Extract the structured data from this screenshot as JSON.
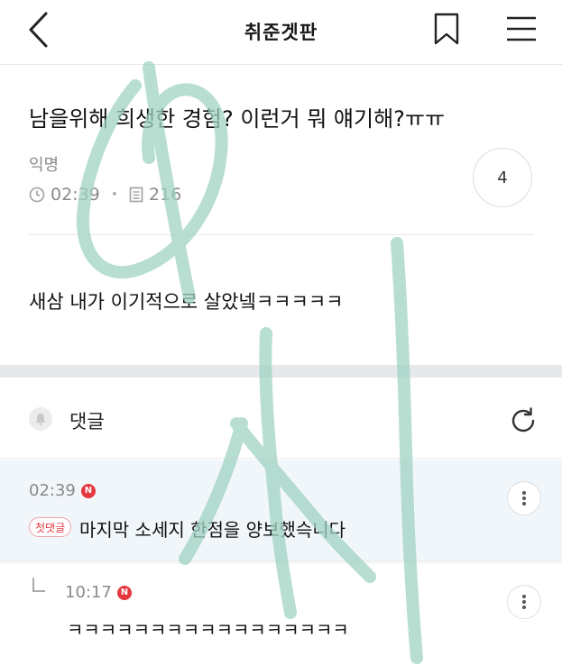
{
  "header": {
    "title": "취준겟판",
    "back_icon": "chevron-left-icon",
    "bookmark_icon": "bookmark-icon",
    "menu_icon": "hamburger-menu-icon"
  },
  "post": {
    "title": "남을위해 희생한 경험? 이런거 뭐 얘기해?ㅠㅠ",
    "author": "익명",
    "time": "02:39",
    "views": "216",
    "like_count": "4",
    "body": "새삼 내가 이기적으로 살았넼ㅋㅋㅋㅋㅋ"
  },
  "comments_section": {
    "label": "댓글",
    "bell_icon": "bell-icon",
    "refresh_icon": "refresh-icon"
  },
  "comments": [
    {
      "time": "02:39",
      "new_badge": "N",
      "first_badge": "첫댓글",
      "text": "마지막 소세지 한점을 양보했슥니다"
    },
    {
      "time": "10:17",
      "new_badge": "N",
      "text": "ㅋㅋㅋㅋㅋㅋㅋㅋㅋㅋㅋㅋㅋㅋㅋㅋㅋ"
    }
  ],
  "colors": {
    "accent_red": "#e5373f",
    "highlight_bg": "#f1f6fb",
    "section_gap": "#e7e8ea",
    "watermark": "#9fd3c2"
  }
}
